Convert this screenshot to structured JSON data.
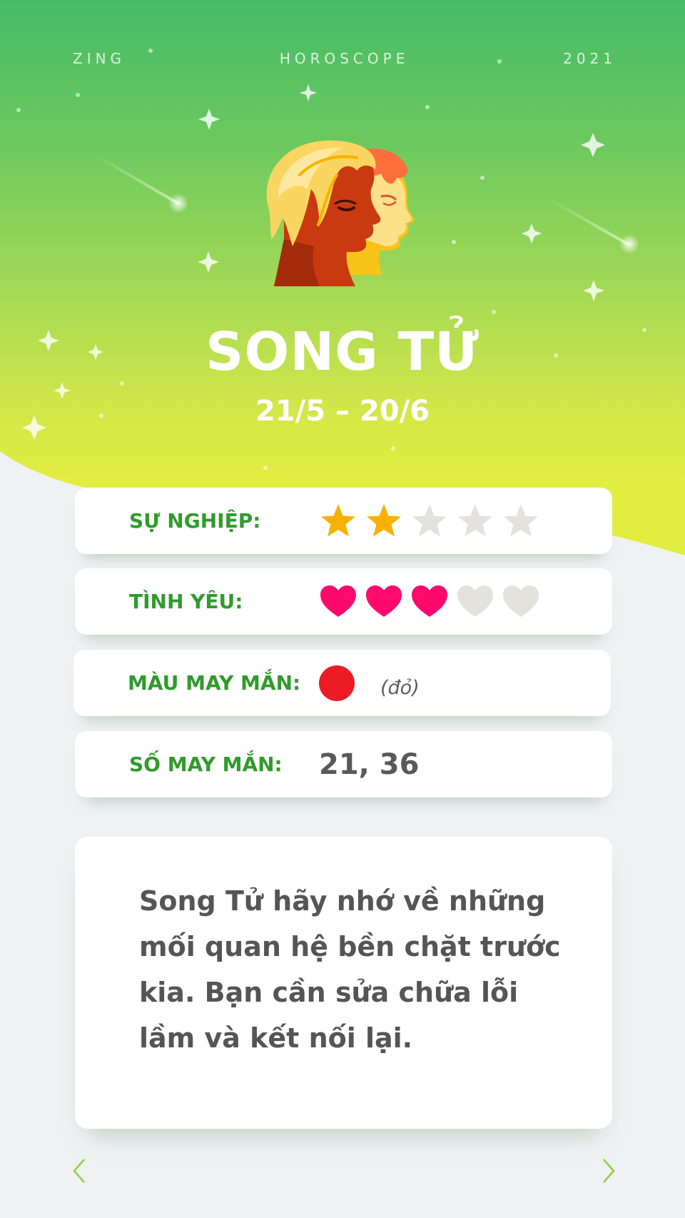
{
  "topbar": {
    "left": "ZING",
    "center": "HOROSCOPE",
    "right": "2021"
  },
  "sign": {
    "name": "SONG TỬ",
    "dates": "21/5 – 20/6",
    "icon": "gemini-twins-icon"
  },
  "ratings": [
    {
      "label": "SỰ NGHIỆP:",
      "type": "star",
      "value": 2,
      "max": 5
    },
    {
      "label": "TÌNH YÊU:",
      "type": "heart",
      "value": 3,
      "max": 5
    }
  ],
  "lucky_color": {
    "label": "MÀU MAY MẮN:",
    "color": "#ed1c24",
    "name": "(đỏ)"
  },
  "lucky_numbers": {
    "label": "SỐ MAY MẮN:",
    "value": "21, 36"
  },
  "description": "Song Tử hãy nhớ về những mối quan hệ bền chặt trước kia. Bạn cần sửa chữa lỗi lầm và kết nối lại.",
  "colors": {
    "label_green": "#2f9b2c",
    "star_on": "#f7b100",
    "heart_on": "#ff0a6c",
    "off": "#e4e2dd"
  },
  "nav": {
    "prev_icon": "chevron-left-icon",
    "next_icon": "chevron-right-icon"
  }
}
